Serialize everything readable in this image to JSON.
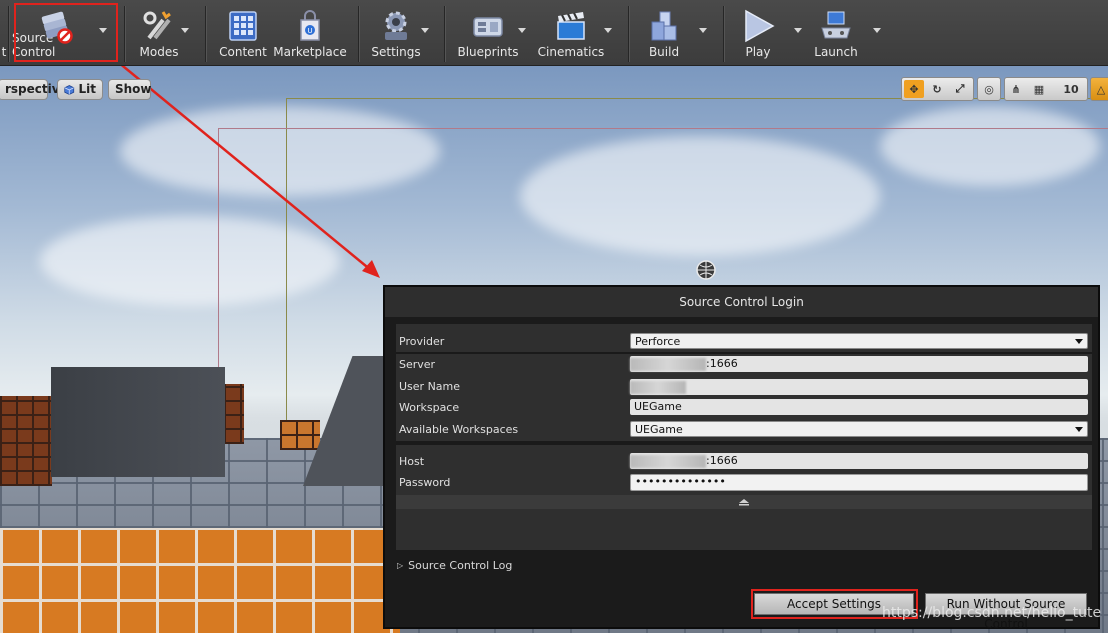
{
  "toolbar": {
    "partial_left_label": "t",
    "buttons": [
      {
        "label": "Source Control",
        "icon": "source-control-icon"
      },
      {
        "label": "Modes",
        "icon": "modes-icon"
      },
      {
        "label": "Content",
        "icon": "content-icon"
      },
      {
        "label": "Marketplace",
        "icon": "marketplace-icon"
      },
      {
        "label": "Settings",
        "icon": "settings-icon"
      },
      {
        "label": "Blueprints",
        "icon": "blueprints-icon"
      },
      {
        "label": "Cinematics",
        "icon": "cinematics-icon"
      },
      {
        "label": "Build",
        "icon": "build-icon"
      },
      {
        "label": "Play",
        "icon": "play-icon"
      },
      {
        "label": "Launch",
        "icon": "launch-icon"
      }
    ]
  },
  "viewport": {
    "perspective_label": "rspective",
    "lit_label": "Lit",
    "show_label": "Show",
    "grid_snap_value": "10"
  },
  "dialog": {
    "title": "Source Control Login",
    "provider": {
      "label": "Provider",
      "value": "Perforce"
    },
    "server": {
      "label": "Server",
      "value": ":1666"
    },
    "user_name": {
      "label": "User Name",
      "value": ""
    },
    "workspace": {
      "label": "Workspace",
      "value": "UEGame"
    },
    "available_workspaces": {
      "label": "Available Workspaces",
      "value": "UEGame"
    },
    "host": {
      "label": "Host",
      "value": ":1666"
    },
    "password": {
      "label": "Password",
      "value": "••••••••••••••"
    },
    "log_label": "Source Control Log",
    "accept_button": "Accept Settings",
    "run_without_button": "Run Without Source Control"
  },
  "watermark": "https://blog.csdn.net/hello_tute",
  "colors": {
    "highlight": "#e0231d",
    "dialog_bg": "#1b1b1b",
    "field_bg": "#e4e4e4"
  }
}
